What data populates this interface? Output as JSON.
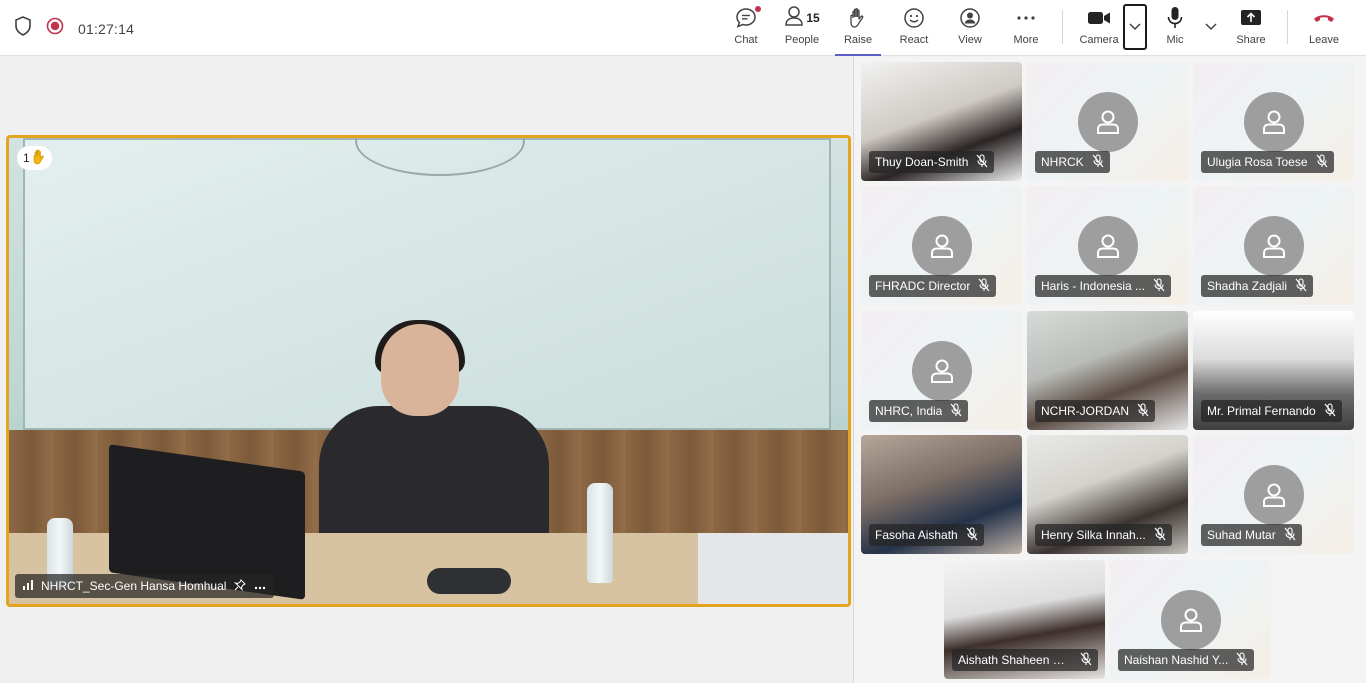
{
  "topbar": {
    "timer": "01:27:14",
    "buttons": {
      "chat": "Chat",
      "people": "People",
      "people_count": "15",
      "raise": "Raise",
      "react": "React",
      "view": "View",
      "more": "More",
      "camera": "Camera",
      "mic": "Mic",
      "share": "Share",
      "leave": "Leave"
    }
  },
  "stage": {
    "raised_hand_count": "1",
    "speaker_name": "NHRCT_Sec-Gen Hansa Homhual"
  },
  "participants": [
    {
      "name": "Thuy Doan-Smith",
      "video": true
    },
    {
      "name": "NHRCK",
      "video": false
    },
    {
      "name": "Ulugia Rosa Toese",
      "video": false
    },
    {
      "name": "FHRADC Director",
      "video": false
    },
    {
      "name": "Haris - Indonesia ...",
      "video": false
    },
    {
      "name": "Shadha Zadjali",
      "video": false
    },
    {
      "name": "NHRC, India",
      "video": false
    },
    {
      "name": "NCHR-JORDAN",
      "video": true
    },
    {
      "name": "Mr. Primal Fernando",
      "video": true
    },
    {
      "name": "Fasoha Aishath",
      "video": true
    },
    {
      "name": "Henry Silka Innah...",
      "video": true
    },
    {
      "name": "Suhad Mutar",
      "video": false
    },
    {
      "name": "Aishath Shaheen Naj...",
      "video": true
    },
    {
      "name": "Naishan Nashid Y...",
      "video": false
    }
  ],
  "colors": {
    "accent": "#5b5fc7",
    "raise_border": "#e4a41f",
    "leave_red": "#c4314b",
    "record_red": "#c4314b"
  }
}
